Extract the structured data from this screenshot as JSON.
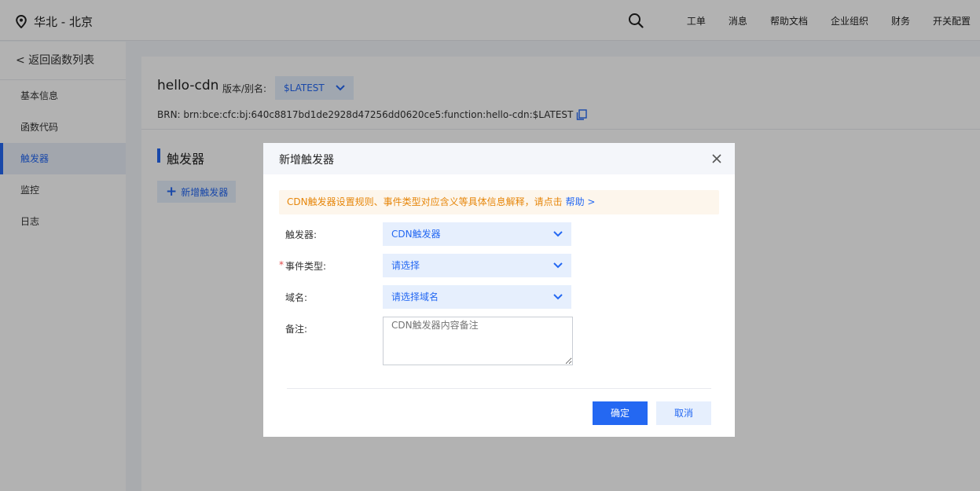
{
  "topbar": {
    "region_icon": "location-pin-icon",
    "region": "华北 - 北京",
    "search_icon": "search-icon",
    "nav": [
      "工单",
      "消息",
      "帮助文档",
      "企业组织",
      "财务",
      "开关配置"
    ]
  },
  "sidebar": {
    "back": "< 返回函数列表",
    "items": [
      {
        "label": "基本信息",
        "active": false
      },
      {
        "label": "函数代码",
        "active": false
      },
      {
        "label": "触发器",
        "active": true
      },
      {
        "label": "监控",
        "active": false
      },
      {
        "label": "日志",
        "active": false
      }
    ]
  },
  "main": {
    "function_name": "hello-cdn",
    "version_label": "版本/别名:",
    "version_value": "$LATEST",
    "brn": "BRN: brn:bce:cfc:bj:640c8817bd1de2928d47256dd0620ce5:function:hello-cdn:$LATEST",
    "copy_icon": "copy-icon",
    "section_title": "触发器",
    "add_button": "新增触发器"
  },
  "modal": {
    "title": "新增触发器",
    "close_icon": "close-icon",
    "notice_text": "CDN触发器设置规则、事件类型对应含义等具体信息解释，请点击",
    "notice_link": "帮助 >",
    "fields": {
      "trigger": {
        "label": "触发器:",
        "value": "CDN触发器"
      },
      "event_type": {
        "label": "事件类型:",
        "required_mark": "*",
        "value": "请选择"
      },
      "domain": {
        "label": "域名:",
        "value": "请选择域名"
      },
      "remark": {
        "label": "备注:",
        "placeholder": "CDN触发器内容备注"
      }
    },
    "confirm": "确定",
    "cancel": "取消"
  },
  "colors": {
    "accent": "#2468f2",
    "accent_light": "#e6effd",
    "notice_text": "#e6860a",
    "notice_bg": "#fdf6ec",
    "required": "#e04b4b"
  }
}
